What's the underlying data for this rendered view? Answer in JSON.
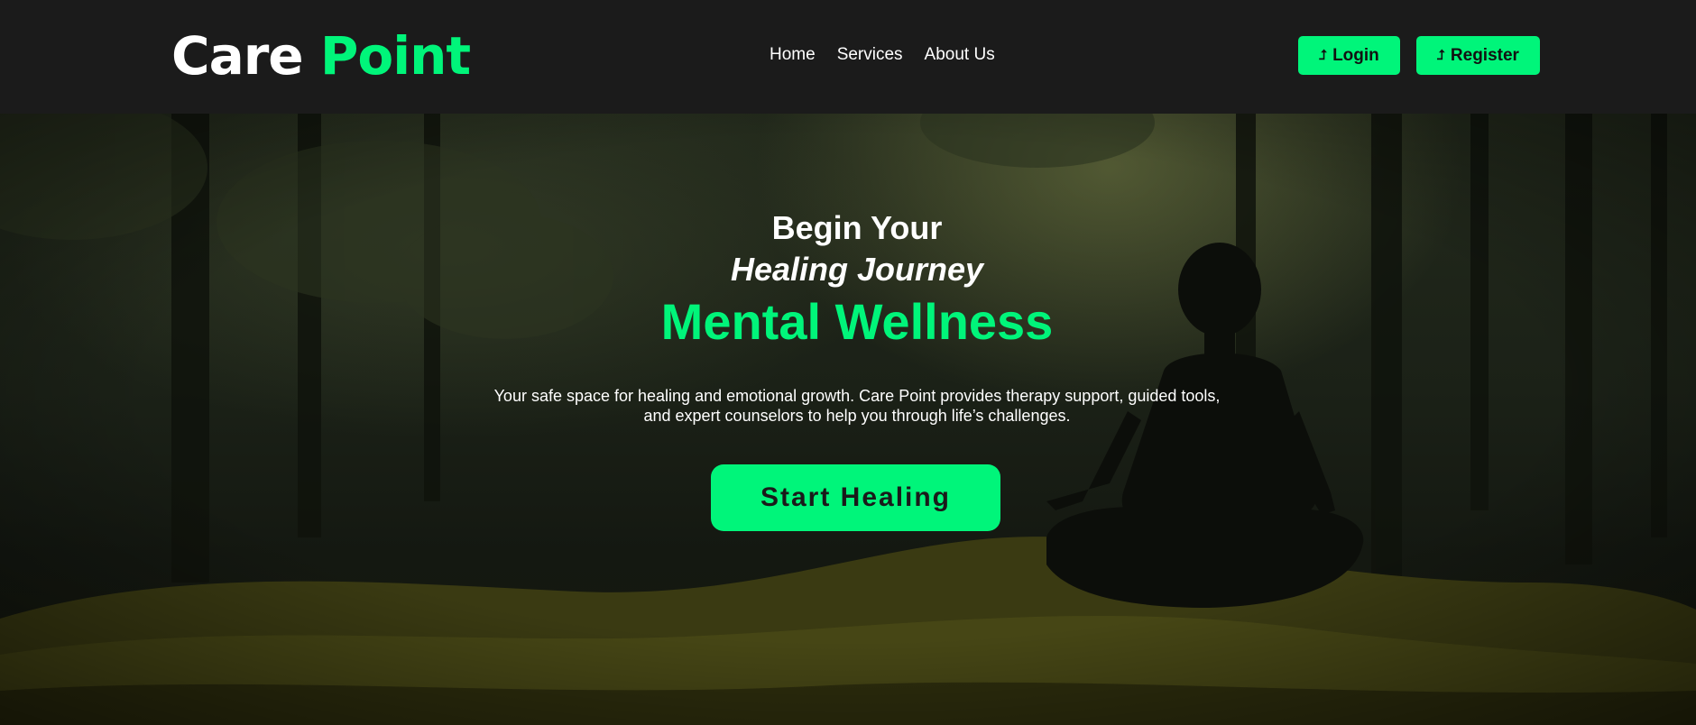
{
  "brand": {
    "part1": "Care",
    "part2": "Point"
  },
  "nav": {
    "links": [
      "Home",
      "Services",
      "About Us"
    ]
  },
  "auth": {
    "login_label": "Login",
    "register_label": "Register",
    "icon": "sign-in-icon"
  },
  "hero": {
    "line1": "Begin Your",
    "line2": "Healing Journey",
    "headline": "Mental Wellness",
    "description": "Your safe space for healing and emotional growth. Care Point provides therapy support, guided tools, and expert counselors to help you through life’s challenges.",
    "cta_label": "Start Healing",
    "background_image": "forest-meditation-photo"
  },
  "colors": {
    "accent": "#00f57a",
    "navbar_bg": "#1b1b1b",
    "text_light": "#ffffff",
    "text_dark": "#111111"
  }
}
